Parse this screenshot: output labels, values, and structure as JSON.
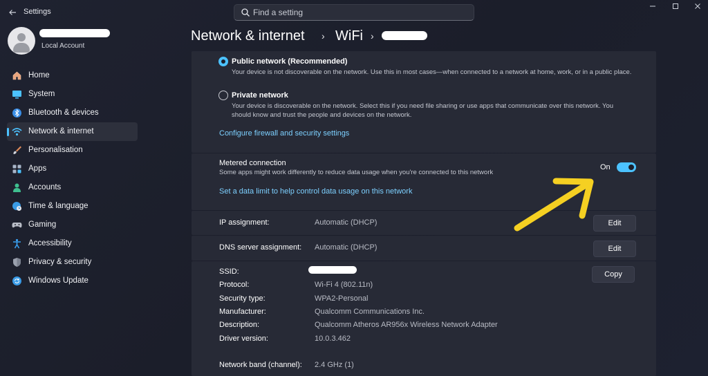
{
  "app": {
    "title": "Settings"
  },
  "search": {
    "placeholder": "Find a setting"
  },
  "profile": {
    "account_type": "Local Account"
  },
  "sidebar": {
    "items": [
      {
        "label": "Home",
        "icon": "home-icon",
        "color": "#e8a37c"
      },
      {
        "label": "System",
        "icon": "system-icon",
        "color": "#4cc2ff"
      },
      {
        "label": "Bluetooth & devices",
        "icon": "bluetooth-icon",
        "color": "#3a8ee6"
      },
      {
        "label": "Network & internet",
        "icon": "wifi-icon",
        "color": "#4cc2ff",
        "active": true
      },
      {
        "label": "Personalisation",
        "icon": "brush-icon",
        "color": "#e08b5a"
      },
      {
        "label": "Apps",
        "icon": "apps-icon",
        "color": "#a9b6c9"
      },
      {
        "label": "Accounts",
        "icon": "accounts-icon",
        "color": "#3fbf8f"
      },
      {
        "label": "Time & language",
        "icon": "globe-clock-icon",
        "color": "#3a9be6"
      },
      {
        "label": "Gaming",
        "icon": "gamepad-icon",
        "color": "#b8bcc6"
      },
      {
        "label": "Accessibility",
        "icon": "accessibility-icon",
        "color": "#3aa0f0"
      },
      {
        "label": "Privacy & security",
        "icon": "shield-icon",
        "color": "#9aa0ad"
      },
      {
        "label": "Windows Update",
        "icon": "update-icon",
        "color": "#3a9be6"
      }
    ]
  },
  "header": {
    "crumb1": "Network & internet",
    "crumb2": "WiFi",
    "separator": "›"
  },
  "network_profile": {
    "public": {
      "title": "Public network (Recommended)",
      "description": "Your device is not discoverable on the network. Use this in most cases—when connected to a network at home, work, or in a public place.",
      "selected": true
    },
    "private": {
      "title": "Private network",
      "description": "Your device is discoverable on the network. Select this if you need file sharing or use apps that communicate over this network. You should know and trust the people and devices on the network.",
      "selected": false
    },
    "firewall_link": "Configure firewall and security settings"
  },
  "metered": {
    "title": "Metered connection",
    "description": "Some apps might work differently to reduce data usage when you're connected to this network",
    "toggle_label": "On",
    "enabled": true,
    "data_limit_link": "Set a data limit to help control data usage on this network"
  },
  "ip": {
    "label": "IP assignment:",
    "value": "Automatic (DHCP)",
    "button": "Edit"
  },
  "dns": {
    "label": "DNS server assignment:",
    "value": "Automatic (DHCP)",
    "button": "Edit"
  },
  "properties": {
    "copy_button": "Copy",
    "rows": [
      {
        "label": "SSID:",
        "value": ""
      },
      {
        "label": "Protocol:",
        "value": "Wi-Fi 4 (802.11n)"
      },
      {
        "label": "Security type:",
        "value": "WPA2-Personal"
      },
      {
        "label": "Manufacturer:",
        "value": "Qualcomm Communications Inc."
      },
      {
        "label": "Description:",
        "value": "Qualcomm Atheros AR956x Wireless Network Adapter"
      },
      {
        "label": "Driver version:",
        "value": "10.0.3.462"
      },
      {
        "label": "Network band (channel):",
        "value": "2.4 GHz (1)"
      }
    ]
  },
  "annotation": {
    "arrow_color": "#f5d022"
  },
  "colors": {
    "accent": "#4cc2ff",
    "link": "#7dd0ff",
    "panel": "#272a36",
    "background": "#1c1f2b"
  }
}
